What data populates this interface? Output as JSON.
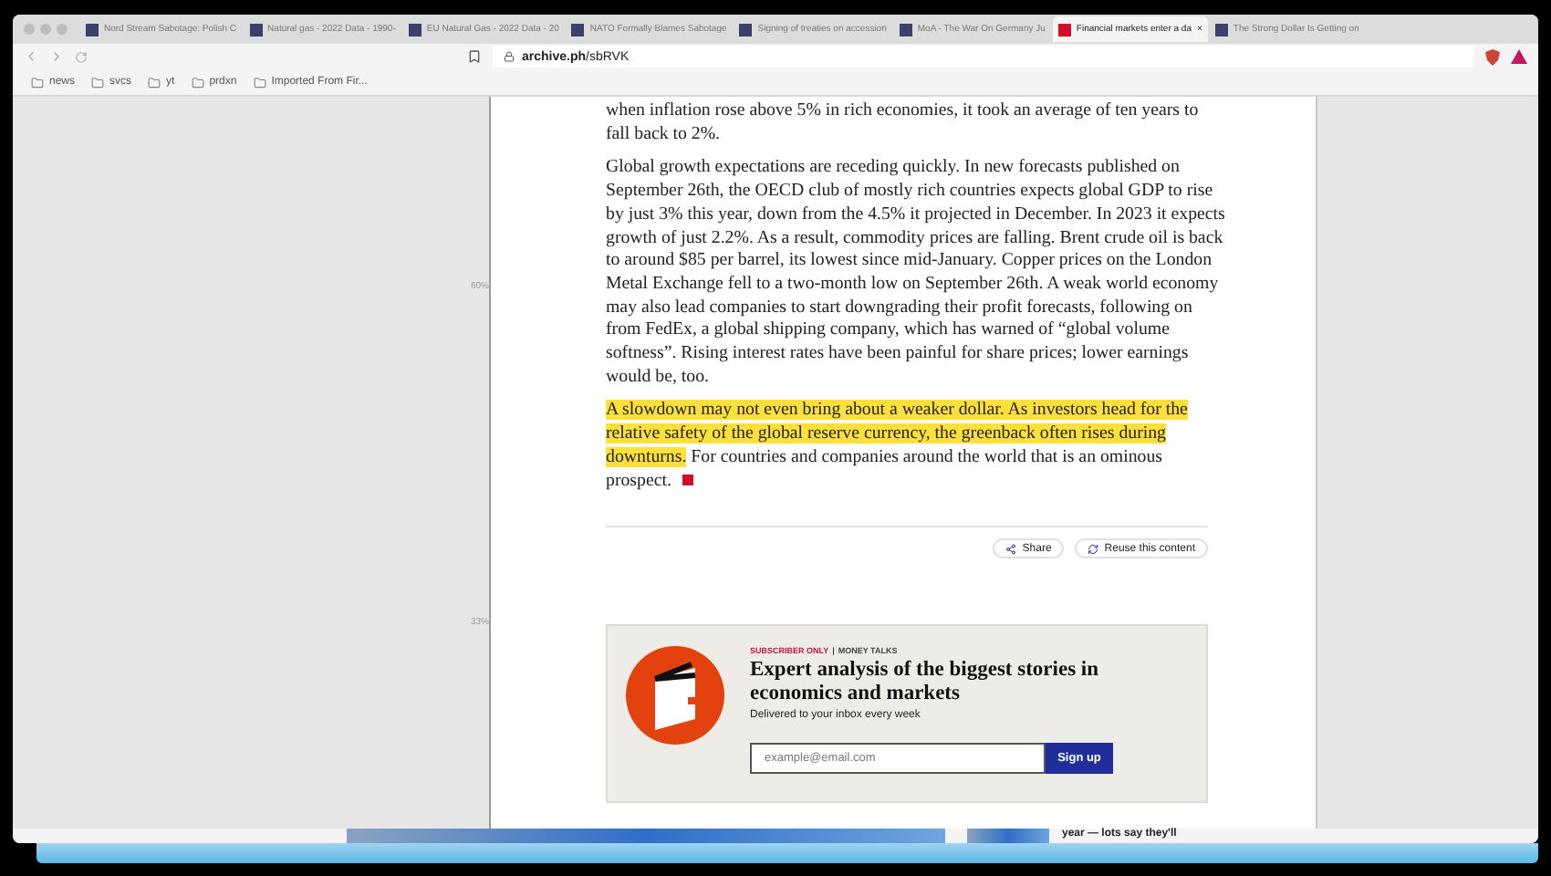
{
  "tabs": [
    {
      "title": "Nord Stream Sabotage: Polish C",
      "selected": false
    },
    {
      "title": "Natural gas - 2022 Data - 1990-",
      "selected": false
    },
    {
      "title": "EU Natural Gas - 2022 Data - 20",
      "selected": false
    },
    {
      "title": "NATO Formally Blames Sabotage",
      "selected": false
    },
    {
      "title": "Signing of treaties on accession",
      "selected": false
    },
    {
      "title": "MoA - The War On Germany Ju",
      "selected": false
    },
    {
      "title": "Financial markets enter a da",
      "selected": true,
      "close": "×"
    },
    {
      "title": "The Strong Dollar Is Getting on",
      "selected": false
    }
  ],
  "address": {
    "host": "archive.ph",
    "path": "/sbRVK"
  },
  "bookmarks": [
    "news",
    "svcs",
    "yt",
    "prdxn",
    "Imported From Fir..."
  ],
  "ruler": [
    "60%",
    "33%"
  ],
  "article": {
    "paragraphs": [
      [
        {
          "text": "when inflation rose above 5% in rich economies, it took an average of ten years to fall back to 2%.",
          "highlighted": false
        }
      ],
      [
        {
          "text": "Global growth expectations are receding quickly. In new forecasts published on September 26th, the OECD club of mostly rich countries expects global GDP to rise by just 3% this year, down from the 4.5% it projected in December. In 2023 it expects growth of just 2.2%. As a result, commodity prices are falling. Brent crude oil is back to around $85 per barrel, its lowest since mid-January. Copper prices on the London Metal Exchange fell to a two-month low on September 26th. A weak world economy may also lead companies to start downgrading their profit forecasts, following on from FedEx, a global shipping company, which has warned of “global volume softness”. Rising interest rates have been painful for share prices; lower earnings would be, too.",
          "highlighted": false
        }
      ],
      [
        {
          "text": "A slowdown may not even bring about a weaker dollar. As investors head for the relative safety of the global reserve currency, the greenback often rises during downturns.",
          "highlighted": true
        },
        {
          "text": " For countries and companies around the world that is an ominous prospect.",
          "highlighted": false
        }
      ]
    ],
    "actions": [
      "Share",
      "Reuse this content"
    ]
  },
  "promo": {
    "label": "SUBSCRIBER ONLY",
    "separator": "|",
    "section": "MONEY TALKS",
    "title": "Expert analysis of the biggest stories in economics and markets",
    "subtitle": "Delivered to your inbox every week",
    "placeholder": "example@email.com",
    "button": "Sign up"
  },
  "below": {
    "teaser": "year — lots say they'll"
  }
}
